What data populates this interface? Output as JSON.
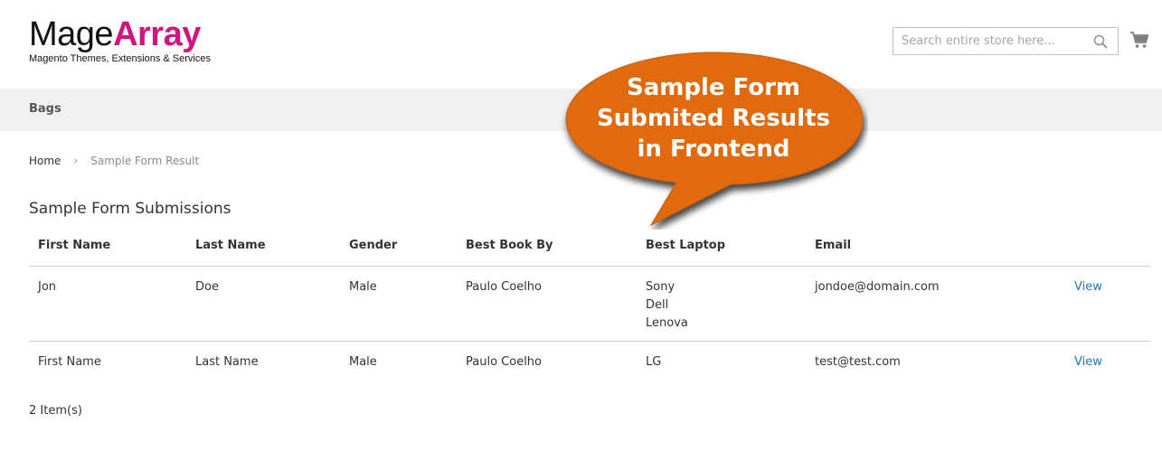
{
  "logo": {
    "main": "Mage",
    "accent": "Array",
    "tagline": "Magento Themes, Extensions & Services"
  },
  "search": {
    "placeholder": "Search entire store here..."
  },
  "nav": {
    "items": [
      {
        "label": "Bags"
      }
    ]
  },
  "breadcrumb": {
    "home": "Home",
    "separator": "›",
    "current": "Sample Form Result"
  },
  "page": {
    "title": "Sample Form Submissions"
  },
  "table": {
    "headers": [
      "First Name",
      "Last Name",
      "Gender",
      "Best Book By",
      "Best Laptop",
      "Email"
    ],
    "rows": [
      {
        "first_name": "Jon",
        "last_name": "Doe",
        "gender": "Male",
        "best_book_by": "Paulo Coelho",
        "best_laptop": [
          "Sony",
          "Dell",
          "Lenova"
        ],
        "email": "jondoe@domain.com",
        "action": "View"
      },
      {
        "first_name": "First Name",
        "last_name": "Last Name",
        "gender": "Male",
        "best_book_by": "Paulo Coelho",
        "best_laptop": [
          "LG"
        ],
        "email": "test@test.com",
        "action": "View"
      }
    ]
  },
  "items_count": "2 Item(s)",
  "callout": {
    "lines": [
      "Sample Form",
      "Submited Results",
      "in Frontend"
    ]
  },
  "colors": {
    "brand_accent": "#d1147f",
    "link": "#1979c3",
    "callout": "#e06a0e",
    "nav_bg": "#f0f0f0"
  },
  "icons": {
    "search": "search-icon",
    "cart": "cart-icon"
  }
}
